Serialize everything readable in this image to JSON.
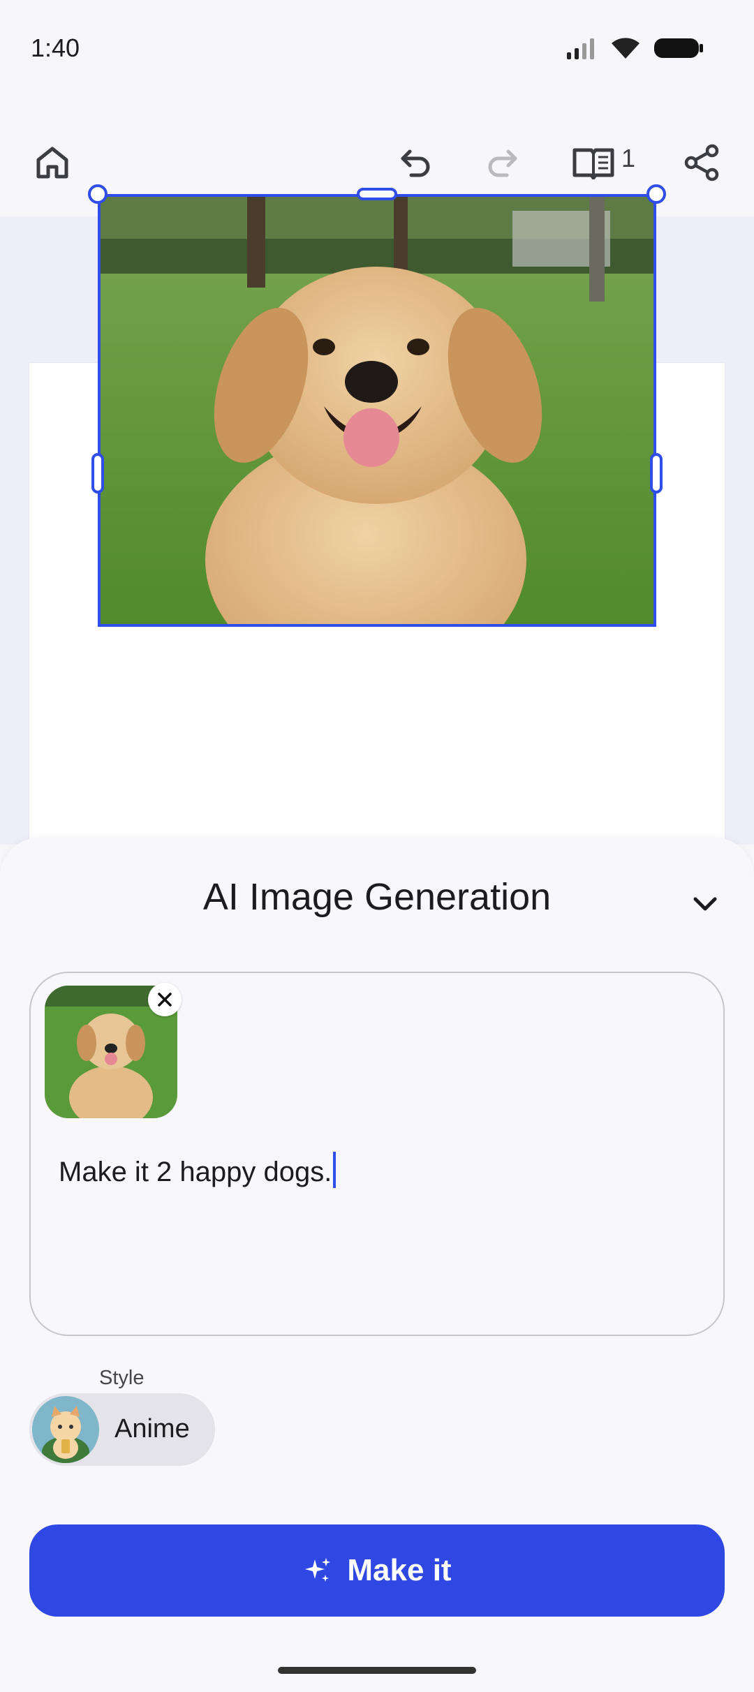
{
  "status_bar": {
    "time": "1:40"
  },
  "toolbar": {
    "page_count": "1"
  },
  "sheet": {
    "title": "AI Image Generation",
    "prompt_text": "Make it 2 happy dogs.",
    "style_label": "Style",
    "style_value": "Anime",
    "action_label": "Make it"
  },
  "colors": {
    "accent": "#2f48e3",
    "selection": "#2f4de8"
  },
  "icons": [
    "home-icon",
    "undo-icon",
    "redo-icon",
    "book-icon",
    "share-icon",
    "chevron-down-icon",
    "close-icon",
    "sparkle-icon"
  ]
}
